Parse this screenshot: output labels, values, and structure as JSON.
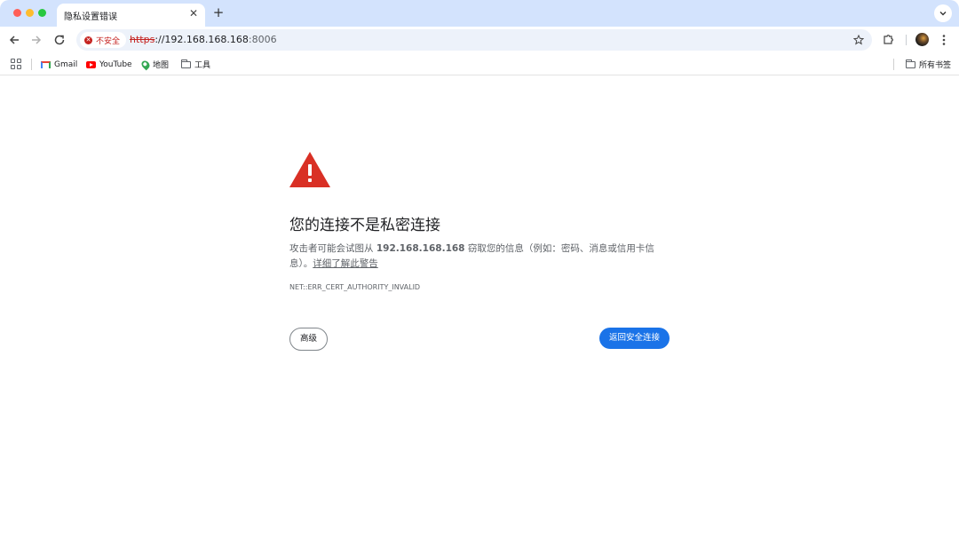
{
  "browser": {
    "tab": {
      "title": "隐私设置错误",
      "close": "✕"
    },
    "new_tab": "+",
    "omnibox": {
      "security_chip": "不安全",
      "url_scheme": "https",
      "url_host": "://192.168.168.168",
      "url_port": ":8006"
    },
    "icons": {
      "back": "arrow-left-icon",
      "forward": "arrow-right-icon",
      "reload": "reload-icon",
      "star": "star-icon",
      "extensions": "puzzle-icon",
      "menu": "kebab-menu-icon"
    }
  },
  "bookmarks": {
    "items": [
      {
        "label": "Gmail"
      },
      {
        "label": "YouTube"
      },
      {
        "label": "地图"
      },
      {
        "label": "工具"
      }
    ],
    "all_bookmarks": "所有书签"
  },
  "interstitial": {
    "heading": "您的连接不是私密连接",
    "para_prefix": "攻击者可能会试图从 ",
    "host": "192.168.168.168",
    "para_suffix": " 窃取您的信息（例如：密码、消息或信用卡信息）。",
    "learn_more": "详细了解此警告",
    "error_code": "NET::ERR_CERT_AUTHORITY_INVALID",
    "advanced_button": "高级",
    "back_button": "返回安全连接"
  },
  "colors": {
    "tabstrip": "#d3e3fd",
    "danger": "#c5221f",
    "primary_button": "#1a73e8",
    "warning_icon": "#d93025"
  }
}
